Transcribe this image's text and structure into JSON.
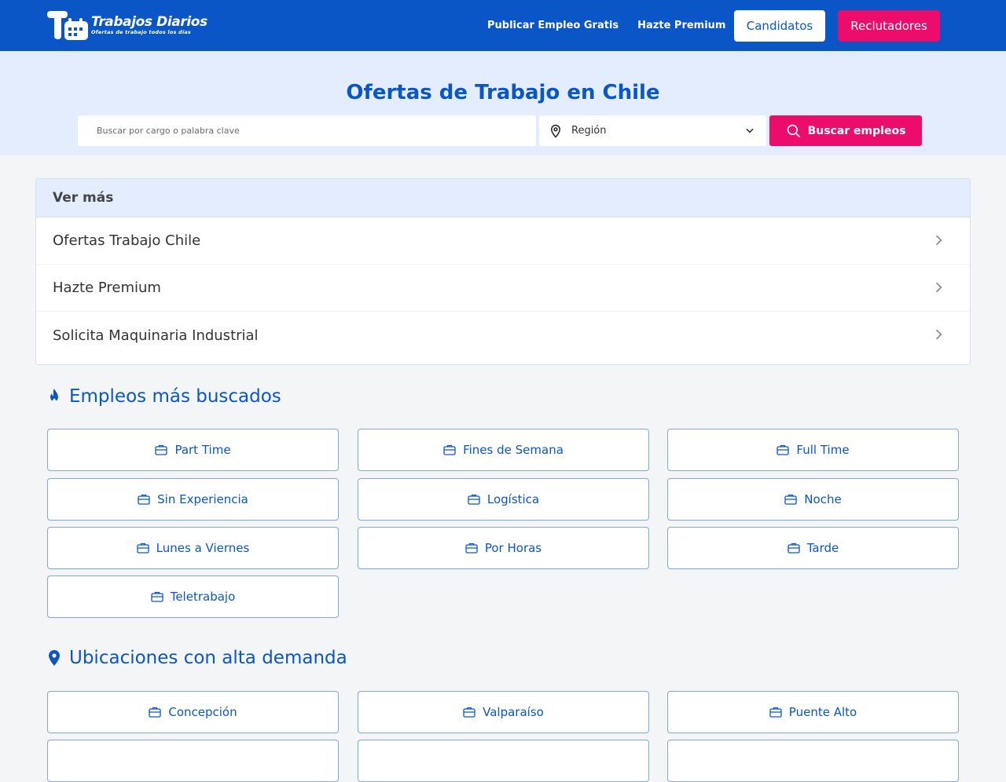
{
  "header": {
    "logo_title": "Trabajos Diarios",
    "logo_subtitle": "Ofertas de trabajo todos los días",
    "nav": [
      "Publicar Empleo Gratis",
      "Hazte Premium"
    ],
    "candidatos_label": "Candidatos",
    "reclutadores_label": "Reclutadores"
  },
  "hero": {
    "title": "Ofertas de Trabajo en Chile",
    "search_placeholder": "Buscar por cargo o palabra clave",
    "search_value": "",
    "region_label": "Región",
    "search_button": "Buscar empleos"
  },
  "ver_mas": {
    "title": "Ver más",
    "items": [
      "Ofertas Trabajo Chile",
      "Hazte Premium",
      "Solicita Maquinaria Industrial"
    ]
  },
  "popular": {
    "title": "Empleos más buscados",
    "items": [
      "Part Time",
      "Fines de Semana",
      "Full Time",
      "Sin Experiencia",
      "Logística",
      "Noche",
      "Lunes a Viernes",
      "Por Horas",
      "Tarde",
      "Teletrabajo"
    ]
  },
  "locations": {
    "title": "Ubicaciones con alta demanda",
    "items": [
      "Concepción",
      "Valparaíso",
      "Puente Alto",
      "",
      "",
      ""
    ]
  },
  "colors": {
    "brand_blue": "#0a56c7",
    "accent_pink": "#ec0c6b",
    "hero_bg": "#e3edfd"
  }
}
